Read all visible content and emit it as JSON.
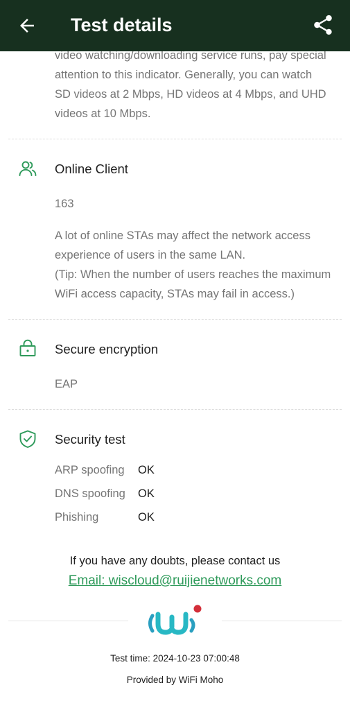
{
  "header": {
    "title": "Test details"
  },
  "top_description": {
    "lines": [
      "video watching/downloading service runs, pay special",
      "attention to this indicator. Generally, you can watch",
      "SD videos at 2 Mbps, HD videos at 4 Mbps, and UHD",
      "videos at 10 Mbps."
    ]
  },
  "online_client": {
    "title": "Online Client",
    "value": "163",
    "description_lines": [
      "A lot of online STAs may affect the network access",
      "experience of users in the same LAN.",
      "(Tip: When the number of users reaches the maximum",
      "WiFi access capacity, STAs may fail in access.)"
    ]
  },
  "secure_encryption": {
    "title": "Secure encryption",
    "value": "EAP"
  },
  "security_test": {
    "title": "Security test",
    "rows": [
      {
        "label": "ARP spoofing",
        "value": "OK"
      },
      {
        "label": "DNS spoofing",
        "value": "OK"
      },
      {
        "label": "Phishing",
        "value": "OK"
      }
    ]
  },
  "contact": {
    "text": "If you have any doubts, please contact us",
    "email": "Email: wiscloud@ruijienetworks.com"
  },
  "footer": {
    "test_time": "Test time: 2024-10-23 07:00:48",
    "provided_by": "Provided by WiFi Moho"
  },
  "colors": {
    "appbar": "#17301f",
    "accent": "#2e9a5a",
    "logo_teal": "#28b8c4",
    "logo_dot": "#d32f3a"
  },
  "icons": [
    "back-arrow-icon",
    "share-icon",
    "users-icon",
    "lock-icon",
    "shield-check-icon",
    "wifi-moho-logo"
  ]
}
